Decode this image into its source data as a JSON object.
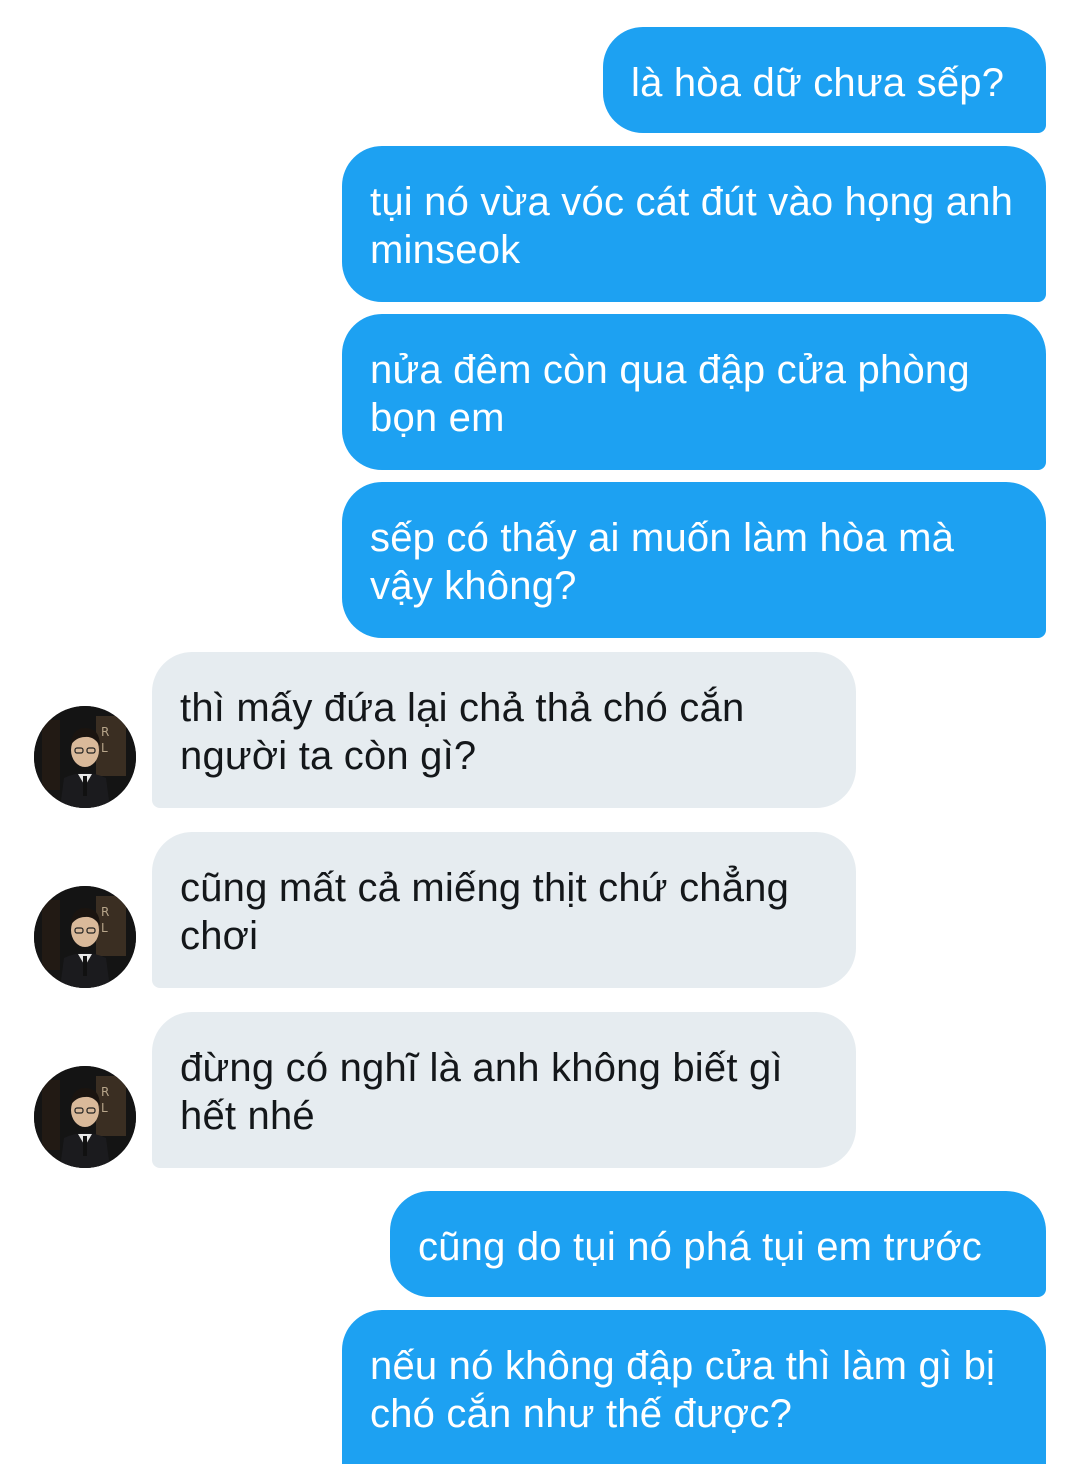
{
  "conversation": {
    "messages": [
      {
        "side": "sent",
        "text": "là hòa dữ chưa sếp?"
      },
      {
        "side": "sent",
        "text": "tụi nó vừa vóc cát đút vào họng anh minseok"
      },
      {
        "side": "sent",
        "text": "nửa đêm còn qua đập cửa phòng bọn em"
      },
      {
        "side": "sent",
        "text": "sếp có thấy ai muốn làm hòa mà vậy không?"
      },
      {
        "side": "received",
        "text": "thì mấy đứa lại chả thả chó cắn người ta còn gì?"
      },
      {
        "side": "received",
        "text": "cũng mất cả miếng thịt chứ chẳng chơi"
      },
      {
        "side": "received",
        "text": "đừng có nghĩ là anh không biết gì hết nhé"
      },
      {
        "side": "sent",
        "text": "cũng do tụi nó phá tụi em trước"
      },
      {
        "side": "sent",
        "text": "nếu nó không đập cửa thì làm gì bị chó cắn như thế được?"
      }
    ]
  },
  "colors": {
    "sent_bubble": "#1da1f2",
    "sent_text": "#ffffff",
    "received_bubble": "#e6ecf0",
    "received_text": "#14171a",
    "background": "#ffffff"
  },
  "icons": {
    "avatar": "profile-photo"
  }
}
